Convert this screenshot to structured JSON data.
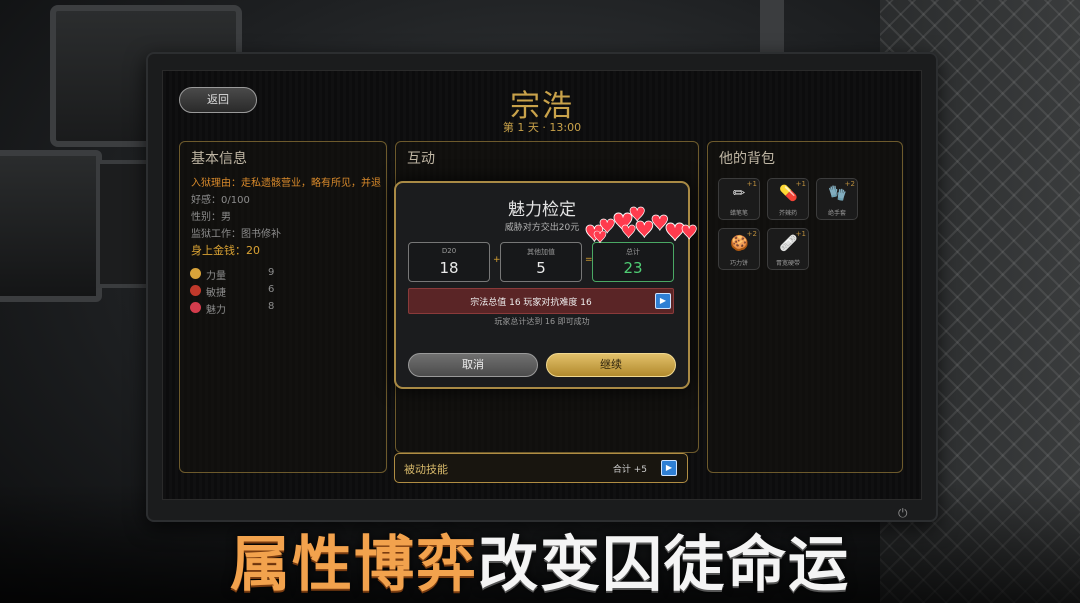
{
  "screen": {
    "back_label": "返回",
    "character_name": "宗浩",
    "day_time": "第 1 天 · 13:00"
  },
  "info_panel": {
    "title": "基本信息",
    "reason": "入狱理由：走私遗骸营业，略有所见，并退换遗物案",
    "favor": "好感：0/100",
    "gender": "性别：男",
    "job": "监狱工作：图书修补",
    "money": "身上金钱：20",
    "attributes": [
      {
        "label": "力量",
        "value": "9",
        "icon": "strength-icon",
        "color": "#d8a33a"
      },
      {
        "label": "敏捷",
        "value": "6",
        "icon": "agility-icon",
        "color": "#c0392b"
      },
      {
        "label": "魅力",
        "value": "8",
        "icon": "charm-heart-icon",
        "color": "#d43c4c"
      }
    ]
  },
  "interaction_panel": {
    "title": "互动"
  },
  "bag_panel": {
    "title": "他的背包",
    "items": [
      {
        "name": "蜡笔笔",
        "count": "+1",
        "icon": "pencil-icon",
        "glyph": "✏"
      },
      {
        "name": "芥辣药",
        "count": "+1",
        "icon": "pill-icon",
        "glyph": "💊"
      },
      {
        "name": "绝手套",
        "count": "+2",
        "icon": "glove-icon",
        "glyph": "🧤"
      },
      {
        "name": "巧力饼",
        "count": "+2",
        "icon": "cookie-icon",
        "glyph": "🍪"
      },
      {
        "name": "胃宽硬带",
        "count": "+1",
        "icon": "bandage-icon",
        "glyph": "🩹"
      }
    ]
  },
  "skill_bar": {
    "label": "被动技能",
    "sum": "合计 +5"
  },
  "dialog": {
    "title": "魅力检定",
    "subtitle": "威胁对方交出20元",
    "d20_label": "D20",
    "d20_value": "18",
    "bonus_label": "其他加值",
    "bonus_value": "5",
    "total_label": "总计",
    "total_value": "23",
    "plus": "+",
    "equals": "=",
    "result_text": "宗法总值 16    玩家对抗难度 16",
    "note": "玩家总计达到 16 即可成功",
    "cancel_label": "取消",
    "continue_label": "继续"
  },
  "banner": {
    "part1": "属性博弈",
    "part2": "改变囚徒命运"
  },
  "colors": {
    "gold": "#c9a24a",
    "success_green": "#4fcd74",
    "result_red": "#5a2526",
    "banner_orange": "#f2a24d"
  }
}
